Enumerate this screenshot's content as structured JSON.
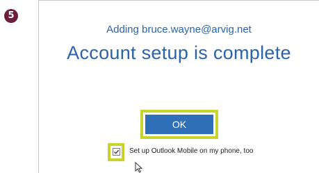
{
  "step": {
    "number": "5",
    "color": "#6b1e3e"
  },
  "dialog": {
    "subtitle": "Adding bruce.wayne@arvig.net",
    "headline": "Account setup is complete",
    "text_color": "#2a63a7"
  },
  "ok_button": {
    "label": "OK",
    "color": "#2f6fb8"
  },
  "mobile_option": {
    "label": "Set up Outlook Mobile on my phone, too",
    "checked": true
  },
  "highlight_color": "#c6d42b",
  "icons": {
    "checkmark": "checkmark-icon",
    "cursor": "mouse-pointer-icon"
  }
}
